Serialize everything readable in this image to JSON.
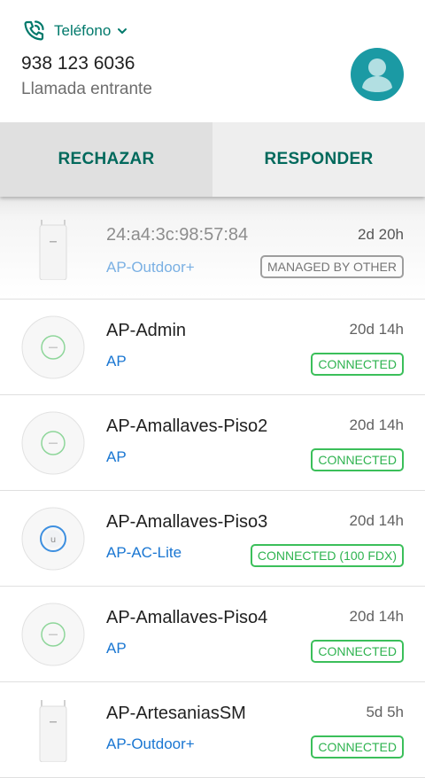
{
  "call": {
    "app_name": "Teléfono",
    "number": "938 123 6036",
    "status": "Llamada entrante",
    "reject_label": "RECHAZAR",
    "answer_label": "RESPONDER",
    "icons": {
      "app": "phone-call-icon",
      "expand": "chevron-down-icon",
      "avatar": "person-icon"
    },
    "colors": {
      "accent": "#00796b",
      "avatar_bg": "#1b9aa4"
    }
  },
  "devices": [
    {
      "name": "24:a4:3c:98:57:84",
      "model": "AP-Outdoor+",
      "uptime": "2d 20h",
      "status": "MANAGED BY OTHER",
      "thumb": "ap-outdoor-icon"
    },
    {
      "name": "AP-Admin",
      "model": "AP",
      "uptime": "20d 14h",
      "status": "CONNECTED",
      "thumb": "ap-disc-icon"
    },
    {
      "name": "AP-Amallaves-Piso2",
      "model": "AP",
      "uptime": "20d 14h",
      "status": "CONNECTED",
      "thumb": "ap-disc-icon"
    },
    {
      "name": "AP-Amallaves-Piso3",
      "model": "AP-AC-Lite",
      "uptime": "20d 14h",
      "status": "CONNECTED (100 FDX)",
      "thumb": "ap-ac-lite-icon"
    },
    {
      "name": "AP-Amallaves-Piso4",
      "model": "AP",
      "uptime": "20d 14h",
      "status": "CONNECTED",
      "thumb": "ap-disc-icon"
    },
    {
      "name": "AP-ArtesaniasSM",
      "model": "AP-Outdoor+",
      "uptime": "5d 5h",
      "status": "CONNECTED",
      "thumb": "ap-outdoor-icon"
    }
  ],
  "colors": {
    "connected": "#2eb34f",
    "model_link": "#1976d2",
    "managed_other": "#757575"
  }
}
